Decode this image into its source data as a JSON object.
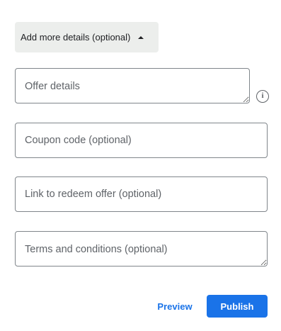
{
  "details_toggle": {
    "label": "Add more details (optional)",
    "icon": "caret-up-icon"
  },
  "fields": {
    "offer_details": {
      "placeholder": "Offer details",
      "value": ""
    },
    "coupon_code": {
      "placeholder": "Coupon code (optional)",
      "value": ""
    },
    "redeem_link": {
      "placeholder": "Link to redeem offer (optional)",
      "value": ""
    },
    "terms": {
      "placeholder": "Terms and conditions (optional)",
      "value": ""
    }
  },
  "info": {
    "icon": "info-icon",
    "glyph": "i"
  },
  "actions": {
    "preview_label": "Preview",
    "publish_label": "Publish"
  },
  "colors": {
    "accent": "#1a73e8",
    "toggle_bg": "#eceeec",
    "border": "#80868b"
  }
}
